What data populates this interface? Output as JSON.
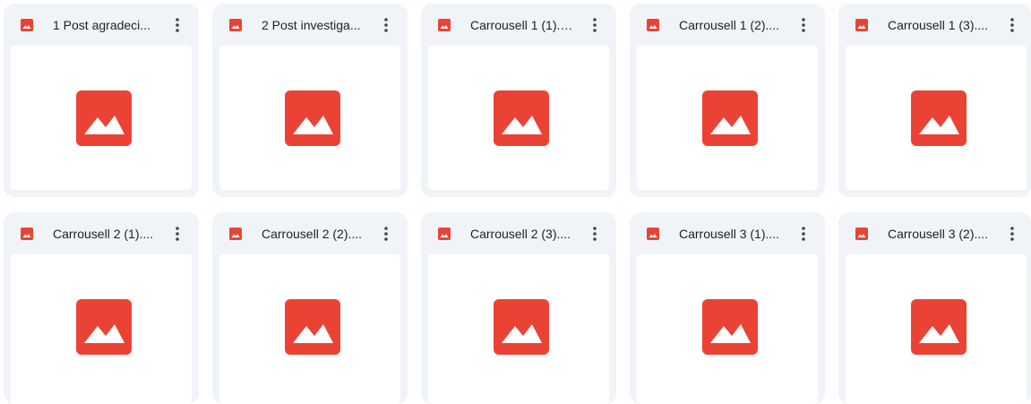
{
  "colors": {
    "card_background": "#f0f4f9",
    "image_icon_red": "#ea4335",
    "title_text": "#1f1f1f",
    "menu_icon": "#444746"
  },
  "files": [
    {
      "name": "1 Post agradeci...",
      "type_icon": "image-file-icon",
      "menu_icon": "more-vert-icon"
    },
    {
      "name": "2 Post investiga...",
      "type_icon": "image-file-icon",
      "menu_icon": "more-vert-icon"
    },
    {
      "name": "Carrousell 1 (1).p...",
      "type_icon": "image-file-icon",
      "menu_icon": "more-vert-icon"
    },
    {
      "name": "Carrousell 1 (2)....",
      "type_icon": "image-file-icon",
      "menu_icon": "more-vert-icon"
    },
    {
      "name": "Carrousell 1 (3)....",
      "type_icon": "image-file-icon",
      "menu_icon": "more-vert-icon"
    },
    {
      "name": "Carrousell 2 (1)....",
      "type_icon": "image-file-icon",
      "menu_icon": "more-vert-icon"
    },
    {
      "name": "Carrousell 2 (2)....",
      "type_icon": "image-file-icon",
      "menu_icon": "more-vert-icon"
    },
    {
      "name": "Carrousell 2 (3)....",
      "type_icon": "image-file-icon",
      "menu_icon": "more-vert-icon"
    },
    {
      "name": "Carrousell 3 (1)....",
      "type_icon": "image-file-icon",
      "menu_icon": "more-vert-icon"
    },
    {
      "name": "Carrousell 3 (2)....",
      "type_icon": "image-file-icon",
      "menu_icon": "more-vert-icon"
    }
  ]
}
